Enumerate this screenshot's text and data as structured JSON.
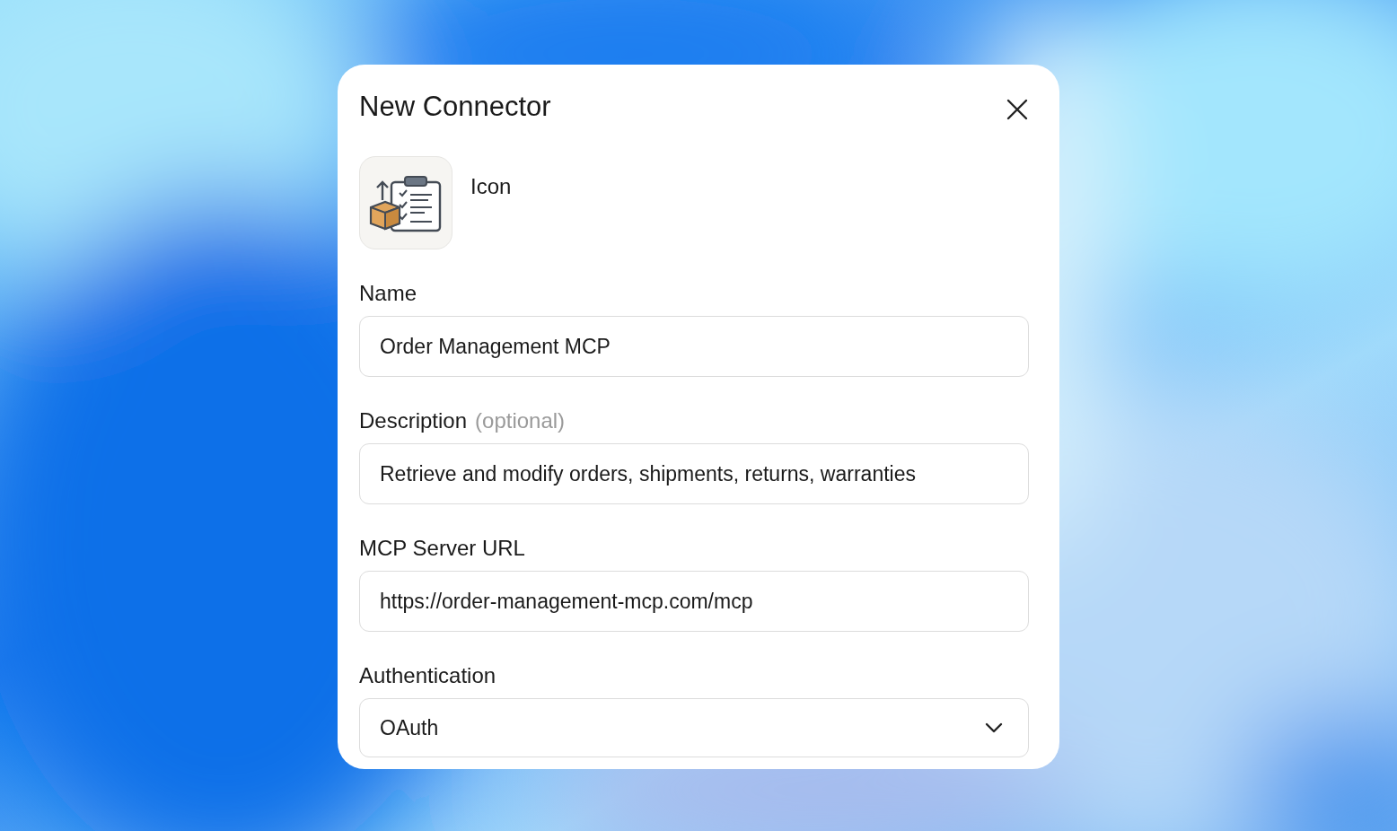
{
  "dialog": {
    "title": "New Connector",
    "icon_label": "Icon",
    "fields": [
      {
        "kind": "text",
        "label": "Name",
        "value": "Order Management MCP"
      },
      {
        "kind": "text",
        "label": "Description",
        "note": "(optional)",
        "value": "Retrieve and modify orders, shipments, returns, warranties"
      },
      {
        "kind": "text",
        "label": "MCP Server URL",
        "value": "https://order-management-mcp.com/mcp"
      },
      {
        "kind": "select",
        "label": "Authentication",
        "value": "OAuth"
      }
    ]
  }
}
